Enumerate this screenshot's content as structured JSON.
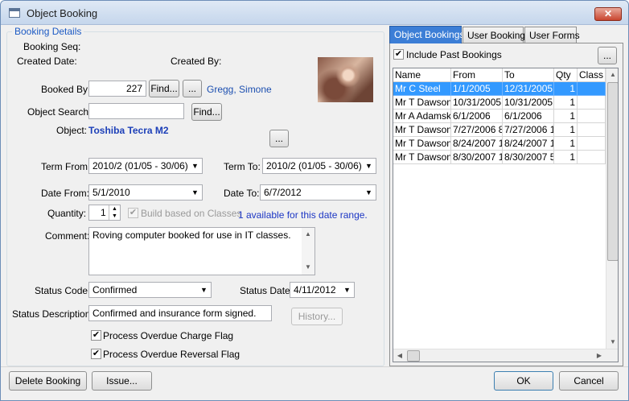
{
  "window": {
    "title": "Object Booking",
    "close": "✕"
  },
  "details": {
    "legend": "Booking Details",
    "booking_seq_label": "Booking Seq:",
    "created_date_label": "Created Date:",
    "created_by_label": "Created By:",
    "booked_by_label": "Booked By:",
    "booked_by_value": "227",
    "find_label": "Find...",
    "ellipsis": "...",
    "booked_by_name": "Gregg, Simone",
    "object_search_label": "Object Search:",
    "object_search_value": "",
    "object_label": "Object:",
    "object_value": "Toshiba Tecra M2",
    "term_from_label": "Term From:",
    "term_from_value": "2010/2 (01/05 - 30/06)",
    "term_to_label": "Term To:",
    "term_to_value": "2010/2 (01/05 - 30/06)",
    "date_from_label": "Date From:",
    "date_from_value": "5/1/2010",
    "date_to_label": "Date To:",
    "date_to_value": "6/7/2012",
    "quantity_label": "Quantity:",
    "quantity_value": "1",
    "build_label": "Build based on Classes",
    "availability": "1 available for this date range.",
    "comment_label": "Comment:",
    "comment_value": "Roving computer booked for use in IT classes.",
    "status_code_label": "Status Code:",
    "status_code_value": "Confirmed",
    "status_date_label": "Status Date:",
    "status_date_value": "4/11/2012",
    "status_desc_label": "Status Description:",
    "status_desc_value": "Confirmed and insurance form signed.",
    "history_label": "History...",
    "overdue_charge_label": "Process Overdue Charge Flag",
    "overdue_reversal_label": "Process Overdue Reversal Flag"
  },
  "tabs": [
    "Object Bookings",
    "User Bookings",
    "User Forms"
  ],
  "bookings": {
    "include_past_label": "Include Past Bookings",
    "ellipsis": "...",
    "columns": [
      "Name",
      "From",
      "To",
      "Qty",
      "Class"
    ],
    "rows": [
      {
        "name": "Mr C Steel",
        "from": "1/1/2005",
        "to": "12/31/2005",
        "qty": "1",
        "class": ""
      },
      {
        "name": "Mr T Dawson",
        "from": "10/31/2005",
        "to": "10/31/2005",
        "qty": "1",
        "class": ""
      },
      {
        "name": "Mr A Adamski",
        "from": "6/1/2006",
        "to": "6/1/2006",
        "qty": "1",
        "class": ""
      },
      {
        "name": "Mr T Dawson",
        "from": "7/27/2006 8:",
        "to": "7/27/2006 1:",
        "qty": "1",
        "class": ""
      },
      {
        "name": "Mr T Dawson",
        "from": "8/24/2007 1:",
        "to": "8/24/2007 1:",
        "qty": "1",
        "class": ""
      },
      {
        "name": "Mr T Dawson",
        "from": "8/30/2007 1(",
        "to": "8/30/2007 5:",
        "qty": "1",
        "class": ""
      }
    ]
  },
  "buttons": {
    "delete": "Delete Booking",
    "issue": "Issue...",
    "ok": "OK",
    "cancel": "Cancel"
  },
  "icons": {
    "check": "✔",
    "down": "▼",
    "up": "▲",
    "left": "◀",
    "right": "▶"
  }
}
